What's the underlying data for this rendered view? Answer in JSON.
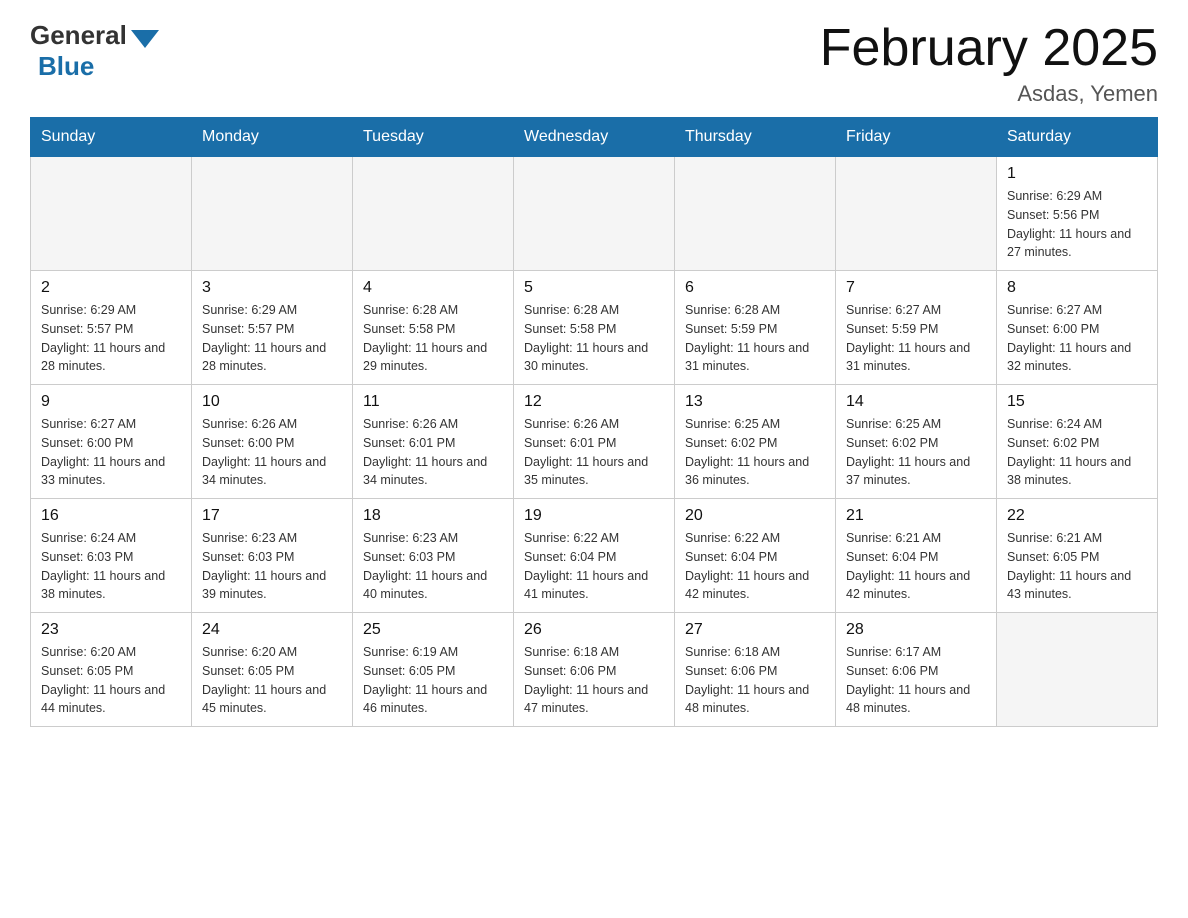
{
  "header": {
    "logo_general": "General",
    "logo_blue": "Blue",
    "title": "February 2025",
    "subtitle": "Asdas, Yemen"
  },
  "days_of_week": [
    "Sunday",
    "Monday",
    "Tuesday",
    "Wednesday",
    "Thursday",
    "Friday",
    "Saturday"
  ],
  "weeks": [
    [
      {
        "day": "",
        "info": ""
      },
      {
        "day": "",
        "info": ""
      },
      {
        "day": "",
        "info": ""
      },
      {
        "day": "",
        "info": ""
      },
      {
        "day": "",
        "info": ""
      },
      {
        "day": "",
        "info": ""
      },
      {
        "day": "1",
        "info": "Sunrise: 6:29 AM\nSunset: 5:56 PM\nDaylight: 11 hours and 27 minutes."
      }
    ],
    [
      {
        "day": "2",
        "info": "Sunrise: 6:29 AM\nSunset: 5:57 PM\nDaylight: 11 hours and 28 minutes."
      },
      {
        "day": "3",
        "info": "Sunrise: 6:29 AM\nSunset: 5:57 PM\nDaylight: 11 hours and 28 minutes."
      },
      {
        "day": "4",
        "info": "Sunrise: 6:28 AM\nSunset: 5:58 PM\nDaylight: 11 hours and 29 minutes."
      },
      {
        "day": "5",
        "info": "Sunrise: 6:28 AM\nSunset: 5:58 PM\nDaylight: 11 hours and 30 minutes."
      },
      {
        "day": "6",
        "info": "Sunrise: 6:28 AM\nSunset: 5:59 PM\nDaylight: 11 hours and 31 minutes."
      },
      {
        "day": "7",
        "info": "Sunrise: 6:27 AM\nSunset: 5:59 PM\nDaylight: 11 hours and 31 minutes."
      },
      {
        "day": "8",
        "info": "Sunrise: 6:27 AM\nSunset: 6:00 PM\nDaylight: 11 hours and 32 minutes."
      }
    ],
    [
      {
        "day": "9",
        "info": "Sunrise: 6:27 AM\nSunset: 6:00 PM\nDaylight: 11 hours and 33 minutes."
      },
      {
        "day": "10",
        "info": "Sunrise: 6:26 AM\nSunset: 6:00 PM\nDaylight: 11 hours and 34 minutes."
      },
      {
        "day": "11",
        "info": "Sunrise: 6:26 AM\nSunset: 6:01 PM\nDaylight: 11 hours and 34 minutes."
      },
      {
        "day": "12",
        "info": "Sunrise: 6:26 AM\nSunset: 6:01 PM\nDaylight: 11 hours and 35 minutes."
      },
      {
        "day": "13",
        "info": "Sunrise: 6:25 AM\nSunset: 6:02 PM\nDaylight: 11 hours and 36 minutes."
      },
      {
        "day": "14",
        "info": "Sunrise: 6:25 AM\nSunset: 6:02 PM\nDaylight: 11 hours and 37 minutes."
      },
      {
        "day": "15",
        "info": "Sunrise: 6:24 AM\nSunset: 6:02 PM\nDaylight: 11 hours and 38 minutes."
      }
    ],
    [
      {
        "day": "16",
        "info": "Sunrise: 6:24 AM\nSunset: 6:03 PM\nDaylight: 11 hours and 38 minutes."
      },
      {
        "day": "17",
        "info": "Sunrise: 6:23 AM\nSunset: 6:03 PM\nDaylight: 11 hours and 39 minutes."
      },
      {
        "day": "18",
        "info": "Sunrise: 6:23 AM\nSunset: 6:03 PM\nDaylight: 11 hours and 40 minutes."
      },
      {
        "day": "19",
        "info": "Sunrise: 6:22 AM\nSunset: 6:04 PM\nDaylight: 11 hours and 41 minutes."
      },
      {
        "day": "20",
        "info": "Sunrise: 6:22 AM\nSunset: 6:04 PM\nDaylight: 11 hours and 42 minutes."
      },
      {
        "day": "21",
        "info": "Sunrise: 6:21 AM\nSunset: 6:04 PM\nDaylight: 11 hours and 42 minutes."
      },
      {
        "day": "22",
        "info": "Sunrise: 6:21 AM\nSunset: 6:05 PM\nDaylight: 11 hours and 43 minutes."
      }
    ],
    [
      {
        "day": "23",
        "info": "Sunrise: 6:20 AM\nSunset: 6:05 PM\nDaylight: 11 hours and 44 minutes."
      },
      {
        "day": "24",
        "info": "Sunrise: 6:20 AM\nSunset: 6:05 PM\nDaylight: 11 hours and 45 minutes."
      },
      {
        "day": "25",
        "info": "Sunrise: 6:19 AM\nSunset: 6:05 PM\nDaylight: 11 hours and 46 minutes."
      },
      {
        "day": "26",
        "info": "Sunrise: 6:18 AM\nSunset: 6:06 PM\nDaylight: 11 hours and 47 minutes."
      },
      {
        "day": "27",
        "info": "Sunrise: 6:18 AM\nSunset: 6:06 PM\nDaylight: 11 hours and 48 minutes."
      },
      {
        "day": "28",
        "info": "Sunrise: 6:17 AM\nSunset: 6:06 PM\nDaylight: 11 hours and 48 minutes."
      },
      {
        "day": "",
        "info": ""
      }
    ]
  ]
}
